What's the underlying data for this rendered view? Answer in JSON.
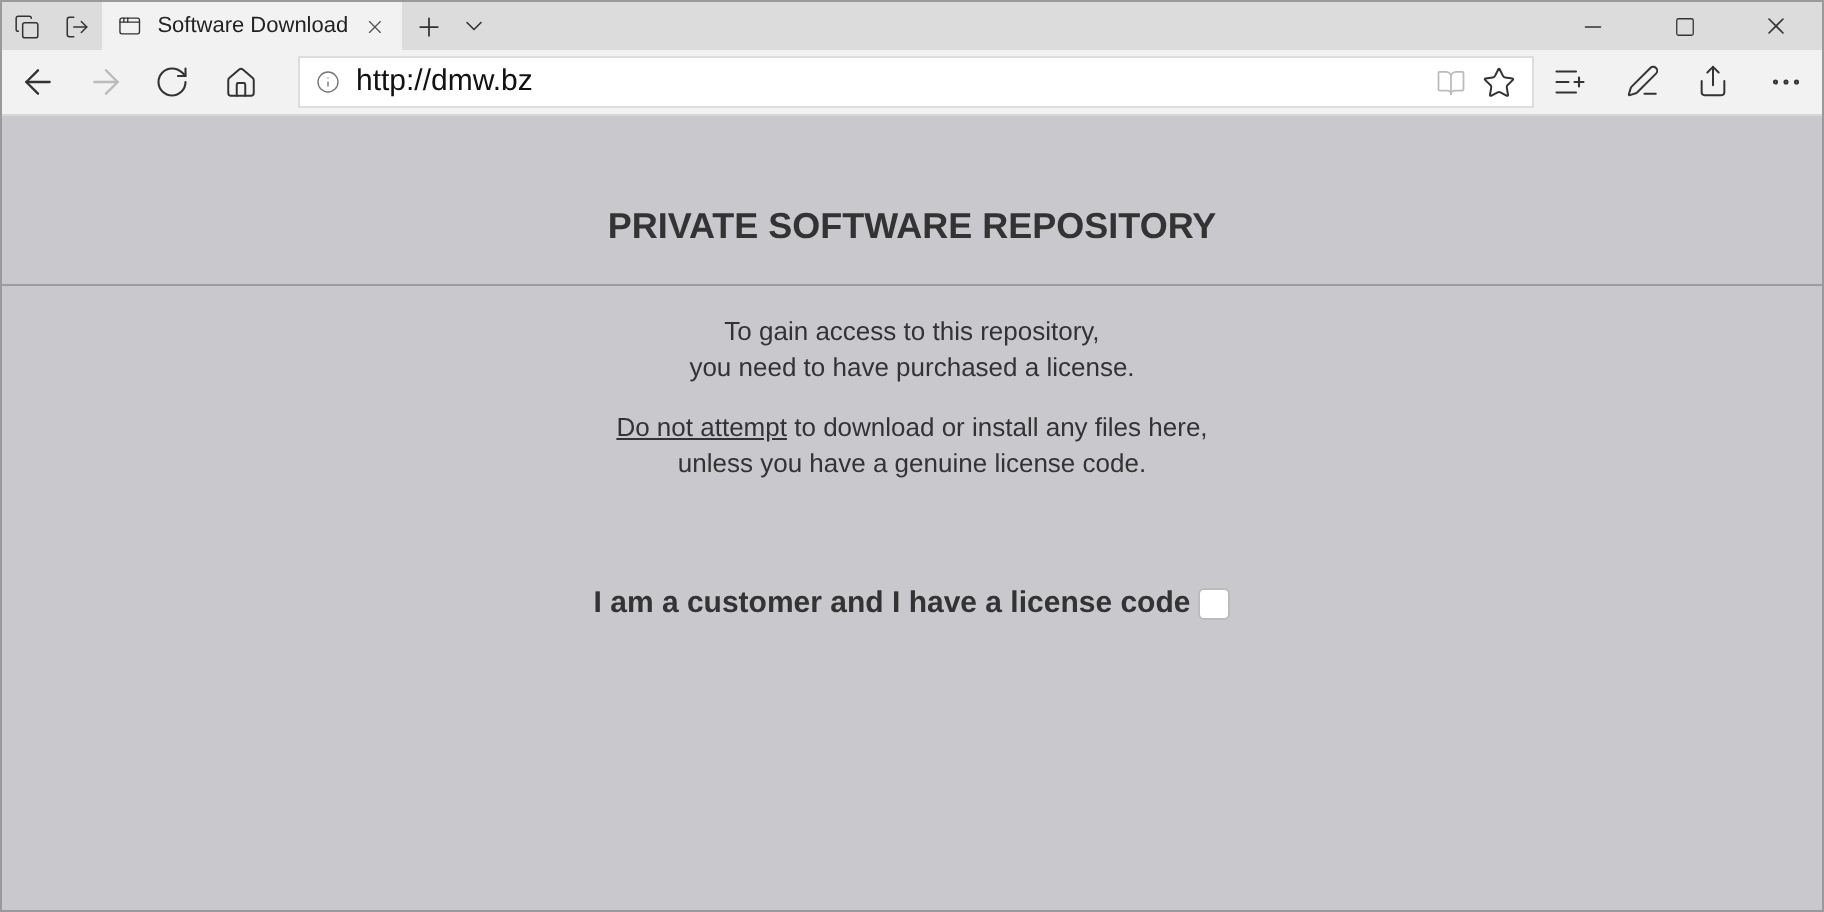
{
  "tab": {
    "title": "Software Download",
    "selected": true
  },
  "address_bar": {
    "url": "http://dmw.bz"
  },
  "page": {
    "heading": "PRIVATE SOFTWARE REPOSITORY",
    "intro": [
      "To gain access to this repository,",
      "you need to have purchased a license."
    ],
    "warning": {
      "link": "Do not attempt",
      "text": "to download or install any files here,",
      "line_2": "unless you have a genuine license code."
    },
    "consent": {
      "label": "I am a customer and I have a license code",
      "checked": false
    }
  }
}
